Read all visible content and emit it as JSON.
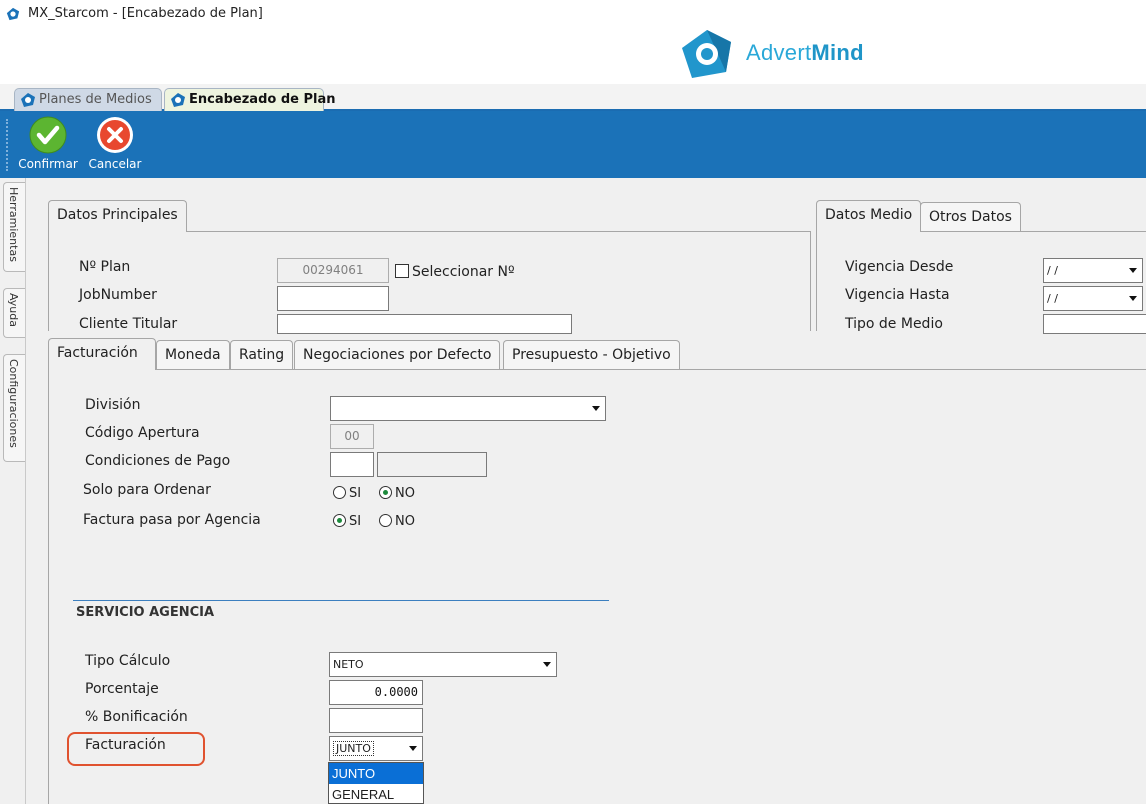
{
  "window": {
    "title": "MX_Starcom - [Encabezado de Plan]"
  },
  "logo": {
    "text_light": "Advert",
    "text_bold": "Mind"
  },
  "doc_tabs": [
    {
      "label": "Planes de Medios"
    },
    {
      "label": "Encabezado de Plan"
    }
  ],
  "toolbar": {
    "confirm_label": "Confirmar",
    "cancel_label": "Cancelar"
  },
  "side_tabs": [
    {
      "label": "Herramientas"
    },
    {
      "label": "Ayuda"
    },
    {
      "label": "Configuraciones"
    }
  ],
  "datos_principales": {
    "tab_label": "Datos Principales",
    "plan_label": "Nº Plan",
    "plan_value": "00294061",
    "seleccionar_label": "Seleccionar Nº",
    "jobnumber_label": "JobNumber",
    "jobnumber_value": "",
    "cliente_label": "Cliente Titular",
    "cliente_value": ""
  },
  "datos_medio": {
    "tabs": [
      {
        "label": "Datos Medio"
      },
      {
        "label": "Otros Datos"
      }
    ],
    "vigencia_desde_label": "Vigencia Desde",
    "vigencia_desde_value": " /  /",
    "vigencia_hasta_label": "Vigencia Hasta",
    "vigencia_hasta_value": " /  /",
    "tipo_medio_label": "Tipo de Medio"
  },
  "detail_tabs": [
    {
      "label": "Facturación"
    },
    {
      "label": "Moneda"
    },
    {
      "label": "Rating"
    },
    {
      "label": "Negociaciones por Defecto"
    },
    {
      "label": "Presupuesto - Objetivo"
    }
  ],
  "facturacion": {
    "division_label": "División",
    "division_value": "",
    "codigo_apertura_label": "Código Apertura",
    "codigo_apertura_value": "00",
    "condiciones_pago_label": "Condiciones de Pago",
    "condiciones_pago_code": "",
    "condiciones_pago_desc": "",
    "solo_ordenar_label": "Solo para Ordenar",
    "solo_ordenar": {
      "si_label": "SI",
      "no_label": "NO",
      "selected": "NO"
    },
    "factura_agencia_label": "Factura pasa por Agencia",
    "factura_agencia": {
      "si_label": "SI",
      "no_label": "NO",
      "selected": "SI"
    }
  },
  "servicio_agencia": {
    "section_title": "SERVICIO AGENCIA",
    "tipo_calculo_label": "Tipo Cálculo",
    "tipo_calculo_value": "NETO",
    "porcentaje_label": "Porcentaje",
    "porcentaje_value": "0.0000",
    "bonificacion_label": "% Bonificación",
    "bonificacion_value": "",
    "facturacion_label": "Facturación",
    "facturacion_value": "JUNTO",
    "facturacion_options": [
      "JUNTO",
      "GENERAL"
    ],
    "facturacion_selected_index": 0
  },
  "colors": {
    "toolbar_bg": "#1b72b8",
    "highlight": "#e0522f",
    "dropdown_selected": "#0a6fd6",
    "logo": "#2aa8d8"
  }
}
